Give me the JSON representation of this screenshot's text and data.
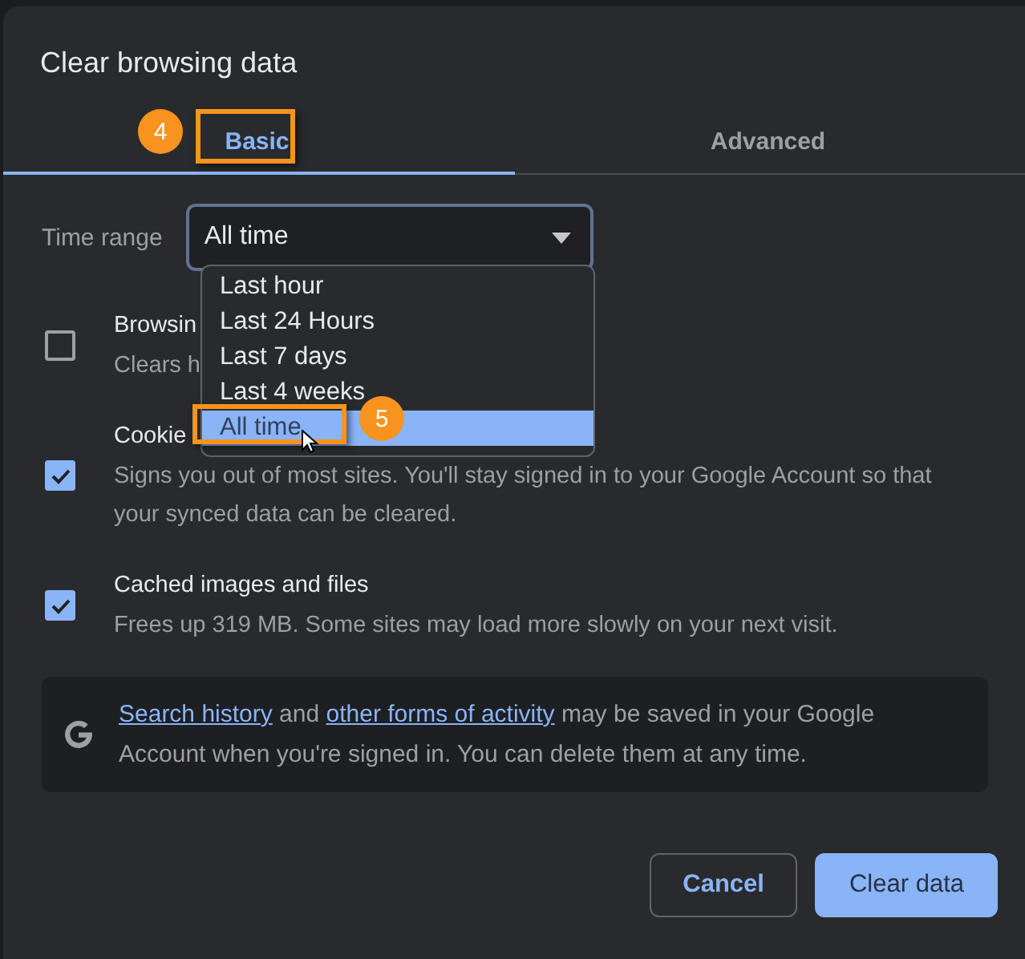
{
  "dialog": {
    "title": "Clear browsing data"
  },
  "tabs": [
    {
      "label": "Basic",
      "selected": true
    },
    {
      "label": "Advanced",
      "selected": false
    }
  ],
  "time_range": {
    "label": "Time range",
    "value": "All time",
    "expanded": true
  },
  "dropdown_options": [
    {
      "label": "Last hour",
      "selected": false
    },
    {
      "label": "Last 24 Hours",
      "selected": false
    },
    {
      "label": "Last 7 days",
      "selected": false
    },
    {
      "label": "Last 4 weeks",
      "selected": false
    },
    {
      "label": "All time",
      "selected": true
    }
  ],
  "items": [
    {
      "title": "Browsin",
      "description": "Clears h",
      "checked": false
    },
    {
      "title": "Cookie",
      "description": "Signs you out of most sites. You'll stay signed in to your Google Account so that your synced data can be cleared.",
      "checked": true
    },
    {
      "title": "Cached images and files",
      "description": "Frees up 319 MB. Some sites may load more slowly on your next visit.",
      "checked": true
    }
  ],
  "info": {
    "link_1": "Search history",
    "text_1": "and",
    "link_2": "other forms of activity",
    "text_2": "may be saved in your Google Account when you're signed in. You can delete them at any time."
  },
  "buttons": [
    {
      "label": "Cancel",
      "kind": "secondary"
    },
    {
      "label": "Clear data",
      "kind": "primary"
    }
  ],
  "annotations": [
    {
      "number": "4"
    },
    {
      "number": "5"
    }
  ]
}
